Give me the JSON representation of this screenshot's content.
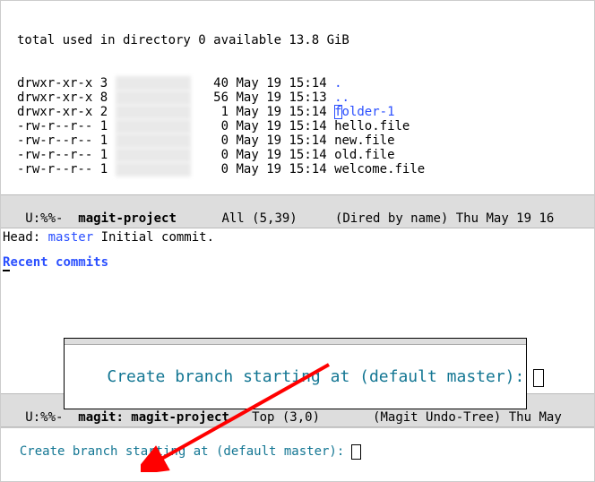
{
  "dired": {
    "summary": "total used in directory 0 available 13.8 GiB",
    "rows": [
      {
        "perms": "drwxr-xr-x 3",
        "size": "40",
        "date": "May 19 15:14",
        "name": ".",
        "cls": "dotname"
      },
      {
        "perms": "drwxr-xr-x 8",
        "size": "56",
        "date": "May 19 15:13",
        "name": "..",
        "cls": "ddotname"
      },
      {
        "perms": "drwxr-xr-x 2",
        "size": "1",
        "date": "May 19 15:14",
        "name": "folder-1",
        "cls": "folderlink",
        "cursor": true
      },
      {
        "perms": "-rw-r--r-- 1",
        "size": "0",
        "date": "May 19 15:14",
        "name": "hello.file",
        "cls": "fname"
      },
      {
        "perms": "-rw-r--r-- 1",
        "size": "0",
        "date": "May 19 15:14",
        "name": "new.file",
        "cls": "fname"
      },
      {
        "perms": "-rw-r--r-- 1",
        "size": "0",
        "date": "May 19 15:14",
        "name": "old.file",
        "cls": "fname"
      },
      {
        "perms": "-rw-r--r-- 1",
        "size": "0",
        "date": "May 19 15:14",
        "name": "welcome.file",
        "cls": "fname"
      }
    ]
  },
  "modeline_dired": {
    "left": " U:%%-  ",
    "buf": "magit-project",
    "pos": "      All (5,39)     ",
    "mode": "(Dired by name)",
    "ts": " Thu May 19 16"
  },
  "magit": {
    "head_label": "Head:    ",
    "branch": "master",
    "commit_msg": " Initial commit.",
    "section": "Recent commits"
  },
  "inset_prompt": "Create branch starting at (default master): ",
  "modeline_magit": {
    "left": " U:%%-  ",
    "buf": "magit: magit-project",
    "pos": "   Top (3,0)       ",
    "mode": "(Magit Undo-Tree)",
    "ts": " Thu May "
  },
  "minibuffer_prompt": "Create branch starting at (default master): "
}
